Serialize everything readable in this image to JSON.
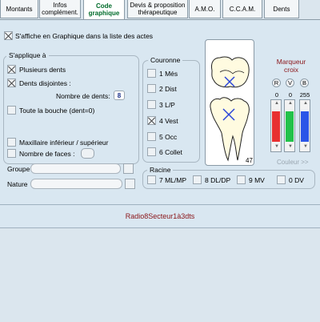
{
  "tabs": [
    {
      "label": "Montants"
    },
    {
      "label": "Infos\ncomplément."
    },
    {
      "label": "Code\ngraphique"
    },
    {
      "label": "Devis & proposition\nthérapeutique"
    },
    {
      "label": "A.M.O."
    },
    {
      "label": "C.C.A.M."
    },
    {
      "label": "Dents"
    }
  ],
  "top_checkbox": {
    "label": "S'affiche en Graphique dans la liste des actes",
    "checked": true
  },
  "applique": {
    "title": "S'applique à",
    "plusieurs": {
      "label": "Plusieurs dents",
      "checked": true
    },
    "disjointes": {
      "label": "Dents disjointes :",
      "checked": true
    },
    "nombre_label": "Nombre de dents:",
    "nombre_value": "8",
    "toute": {
      "label": "Toute la bouche (dent=0)",
      "checked": false
    },
    "maxillaire": {
      "label": "Maxillaire inférieur / supérieur",
      "checked": false
    },
    "faces": {
      "label": "Nombre de faces :",
      "checked": false
    },
    "groupe_label": "Groupe",
    "nature_label": "Nature"
  },
  "couronne": {
    "title": "Couronne",
    "items": [
      {
        "label": "1 Més",
        "checked": false
      },
      {
        "label": "2 Dist",
        "checked": false
      },
      {
        "label": "3 L/P",
        "checked": false
      },
      {
        "label": "4 Vest",
        "checked": true
      },
      {
        "label": "5 Occ",
        "checked": false
      },
      {
        "label": "6 Collet",
        "checked": false
      }
    ]
  },
  "tooth_number": "47",
  "marqueur": {
    "title": "Marqueur\ncroix",
    "r_label": "R",
    "v_label": "V",
    "b_label": "B",
    "r": "0",
    "v": "0",
    "b": "255",
    "couleur_label": "Couleur >>"
  },
  "racine": {
    "title": "Racine",
    "items": [
      {
        "label": "7 ML/MP"
      },
      {
        "label": "8 DL/DP"
      },
      {
        "label": "9 MV"
      },
      {
        "label": "0 DV"
      }
    ]
  },
  "bottom_label": "Radio8Secteur1à3dts",
  "colors": {
    "accent_text": "#8a1418",
    "active_tab": "#006b2a",
    "red": "#e83030",
    "green": "#22c24a",
    "blue": "#2a55e8"
  }
}
